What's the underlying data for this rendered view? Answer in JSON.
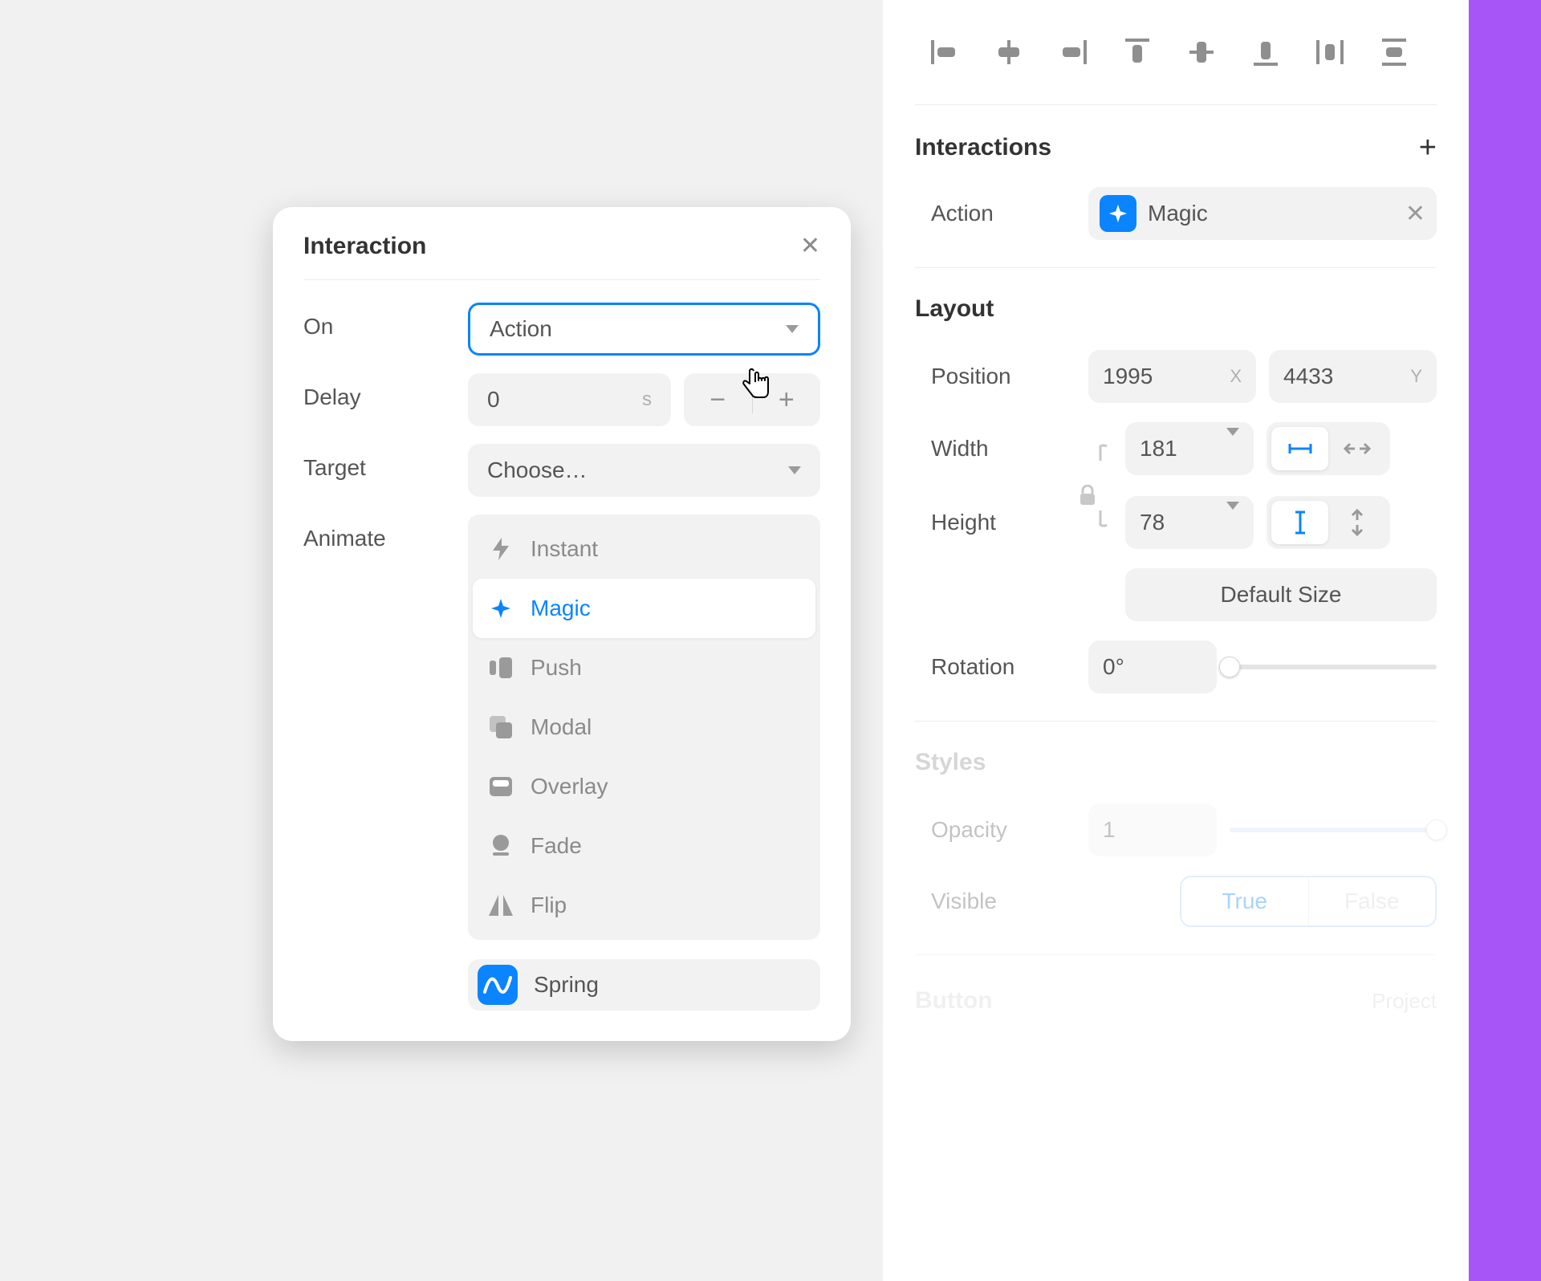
{
  "popover": {
    "title": "Interaction",
    "on_label": "On",
    "on_value": "Action",
    "delay_label": "Delay",
    "delay_value": "0",
    "delay_unit": "s",
    "target_label": "Target",
    "target_value": "Choose…",
    "animate_label": "Animate",
    "animate_options": {
      "instant": "Instant",
      "magic": "Magic",
      "push": "Push",
      "modal": "Modal",
      "overlay": "Overlay",
      "fade": "Fade",
      "flip": "Flip"
    },
    "spring_label": "Spring"
  },
  "inspector": {
    "interactions": {
      "title": "Interactions",
      "action_label": "Action",
      "action_value": "Magic"
    },
    "layout": {
      "title": "Layout",
      "position_label": "Position",
      "position_x": "1995",
      "position_x_suffix": "X",
      "position_y": "4433",
      "position_y_suffix": "Y",
      "width_label": "Width",
      "width_value": "181",
      "height_label": "Height",
      "height_value": "78",
      "default_size": "Default Size",
      "rotation_label": "Rotation",
      "rotation_value": "0°"
    },
    "styles": {
      "title": "Styles",
      "opacity_label": "Opacity",
      "opacity_value": "1",
      "visible_label": "Visible",
      "visible_true": "True",
      "visible_false": "False"
    },
    "footer": {
      "left": "Button",
      "right": "Project"
    }
  },
  "colors": {
    "accent": "#0a84ff",
    "purple": "#a855f7"
  }
}
